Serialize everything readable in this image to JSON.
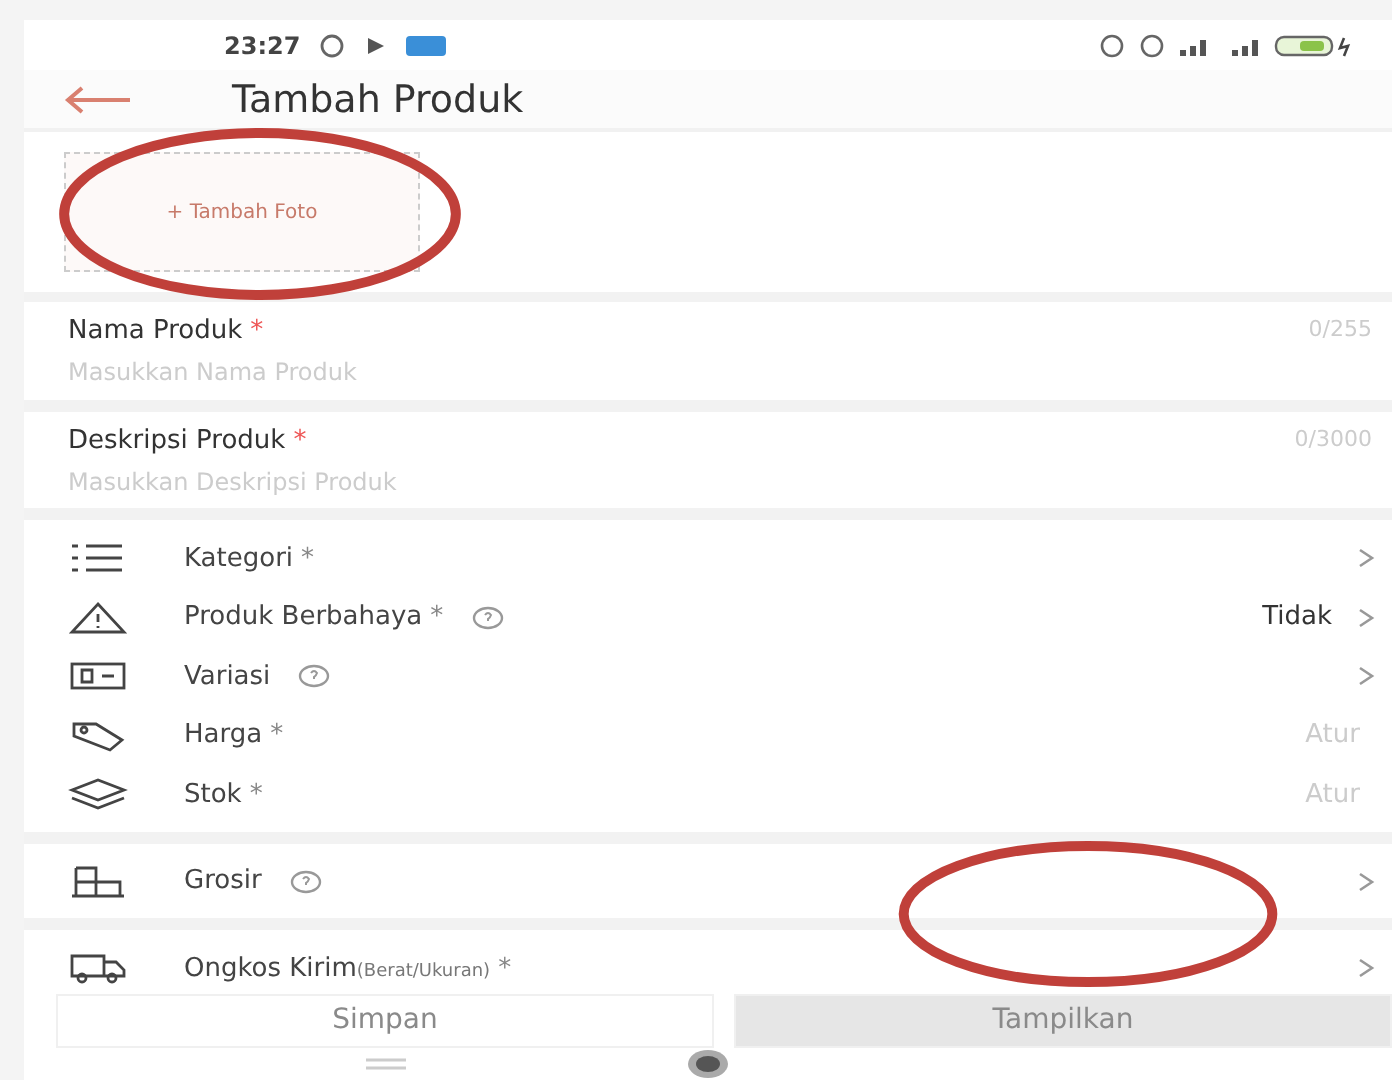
{
  "status_bar": {
    "time": "23:27"
  },
  "header": {
    "title": "Tambah Produk"
  },
  "photo": {
    "label": "+ Tambah Foto"
  },
  "fields": [
    {
      "label": "Nama Produk",
      "marker": "*",
      "counter": "0/255",
      "placeholder": "Masukkan Nama Produk"
    },
    {
      "label": "Deskripsi Produk",
      "marker": "*",
      "counter": "0/3000",
      "placeholder": "Masukkan Deskripsi Produk"
    }
  ],
  "sections": [
    {
      "rows": [
        {
          "kind": "list",
          "label": "Kategori",
          "marker": "*",
          "help": false,
          "chevron": true
        },
        {
          "kind": "warning",
          "label": "Produk Berbahaya",
          "marker": "*",
          "help": true,
          "value": "Tidak",
          "muted": false,
          "chevron": true
        },
        {
          "kind": "variant",
          "label": "Variasi",
          "help": true,
          "chevron": true
        },
        {
          "kind": "tag",
          "label": "Harga",
          "marker": "*",
          "help": false,
          "value": "Atur",
          "muted": true,
          "chevron": false
        },
        {
          "kind": "stack",
          "label": "Stok",
          "marker": "*",
          "help": false,
          "value": "Atur",
          "muted": true,
          "chevron": false
        }
      ]
    },
    {
      "rows": [
        {
          "kind": "boxes",
          "label": "Grosir",
          "help": true,
          "chevron": true
        }
      ]
    },
    {
      "rows": [
        {
          "kind": "truck",
          "label": "Ongkos Kirim",
          "note": "(Berat/Ukuran)",
          "marker": "*",
          "help": false,
          "chevron": true
        }
      ]
    }
  ],
  "footer": {
    "buttons": [
      {
        "label": "Simpan",
        "kind": "secondary",
        "disabled": true
      },
      {
        "label": "Tampilkan",
        "kind": "primary",
        "disabled": true
      }
    ]
  },
  "annotations": [
    {
      "kind": "ellipse"
    },
    {
      "kind": "ellipse"
    }
  ]
}
